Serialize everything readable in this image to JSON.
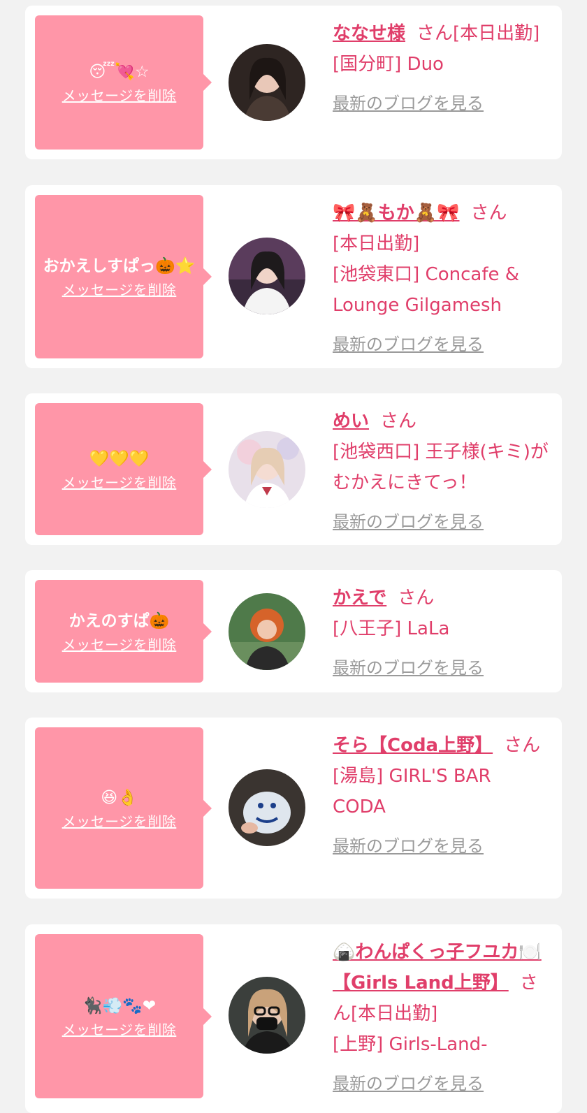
{
  "delete_label": "メッセージを削除",
  "san_label": "さん",
  "blog_label": "最新のブログを見る",
  "items": [
    {
      "message": "😴💘☆",
      "name": "ななせ様",
      "status": "[本日出勤]",
      "shop": "[国分町] Duo"
    },
    {
      "message": "おかえしすぱっ🎃⭐",
      "name": "🎀🧸もか🧸🎀",
      "status": "[本日出勤]",
      "shop": "[池袋東口] Concafe & Lounge Gilgamesh"
    },
    {
      "message": "💛💛💛",
      "name": "めい",
      "status": "",
      "shop": "[池袋西口] 王子様(キミ)がむかえにきてっ！"
    },
    {
      "message": "かえのすぱ🎃",
      "name": "かえで",
      "status": "",
      "shop": "[八王子] LaLa"
    },
    {
      "message": "😆👌",
      "name": "そら【Coda上野】",
      "status": "",
      "shop": "[湯島] GIRL'S BAR CODA"
    },
    {
      "message": "🐈‍⬛💨🐾❤",
      "name": "🍙わんぱくっ子フユカ🍽️【Girls Land上野】",
      "status": "[本日出勤]",
      "shop": "[上野] Girls-Land-"
    }
  ]
}
